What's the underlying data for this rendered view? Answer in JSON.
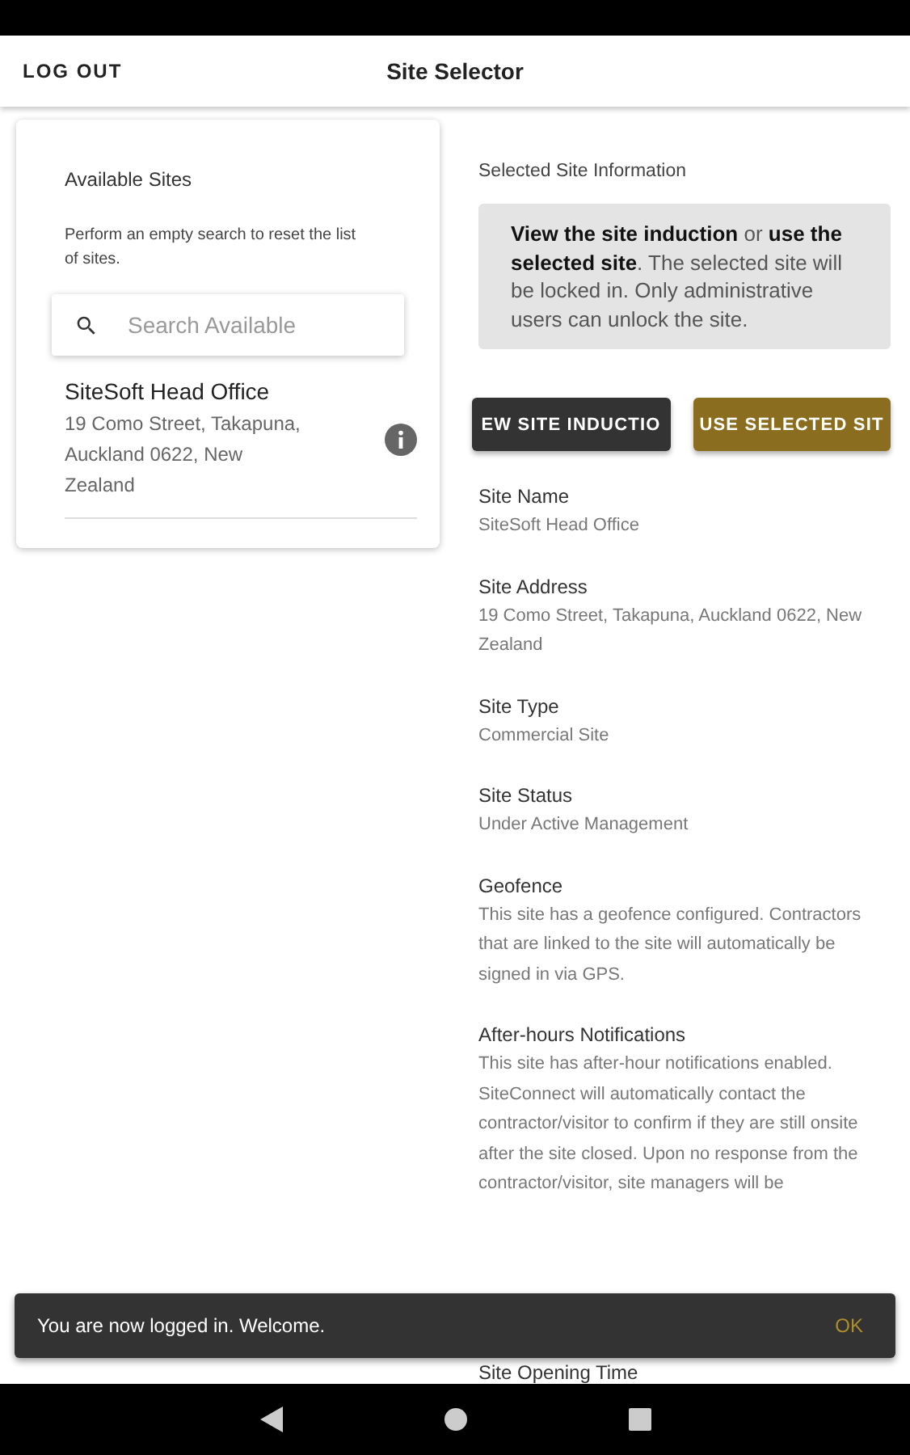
{
  "app_bar": {
    "logout": "LOG OUT",
    "title": "Site Selector"
  },
  "available_sites": {
    "title": "Available Sites",
    "hint": "Perform an empty search to reset the list of sites.",
    "search": {
      "placeholder": "Search Available"
    },
    "sites": [
      {
        "name": "SiteSoft Head Office",
        "address": "19 Como Street, Takapuna, Auckland 0622, New Zealand"
      }
    ]
  },
  "selected_site": {
    "title": "Selected Site Information",
    "notice": "**View the site induction** or **use the selected site**. The selected site will be locked in. Only administrative users can unlock the site.",
    "buttons": [
      {
        "label": "EW SITE INDUCTIO",
        "kind": "dark"
      },
      {
        "label": "USE SELECTED SIT",
        "kind": "gold"
      }
    ],
    "details": [
      {
        "label": "Site Name",
        "value": "SiteSoft Head Office"
      },
      {
        "label": "Site Address",
        "value": "19 Como Street, Takapuna, Auckland 0622, New Zealand"
      },
      {
        "label": "Site Type",
        "value": "Commercial Site"
      },
      {
        "label": "Site Status",
        "value": "Under Active Management"
      },
      {
        "label": "Geofence",
        "value": "This site has a geofence configured. Contractors that are linked to the site will automatically be signed in via GPS."
      },
      {
        "label": "After-hours Notifications",
        "value": "This site has after-hour notifications enabled. SiteConnect will automatically contact the contractor/visitor to confirm if they are still onsite after the site closed. Upon no response from the contractor/visitor, site managers will be"
      },
      {
        "label": "Site Opening Time"
      }
    ]
  },
  "snackbar": {
    "message": "You are now logged in. Welcome.",
    "action": "OK"
  }
}
